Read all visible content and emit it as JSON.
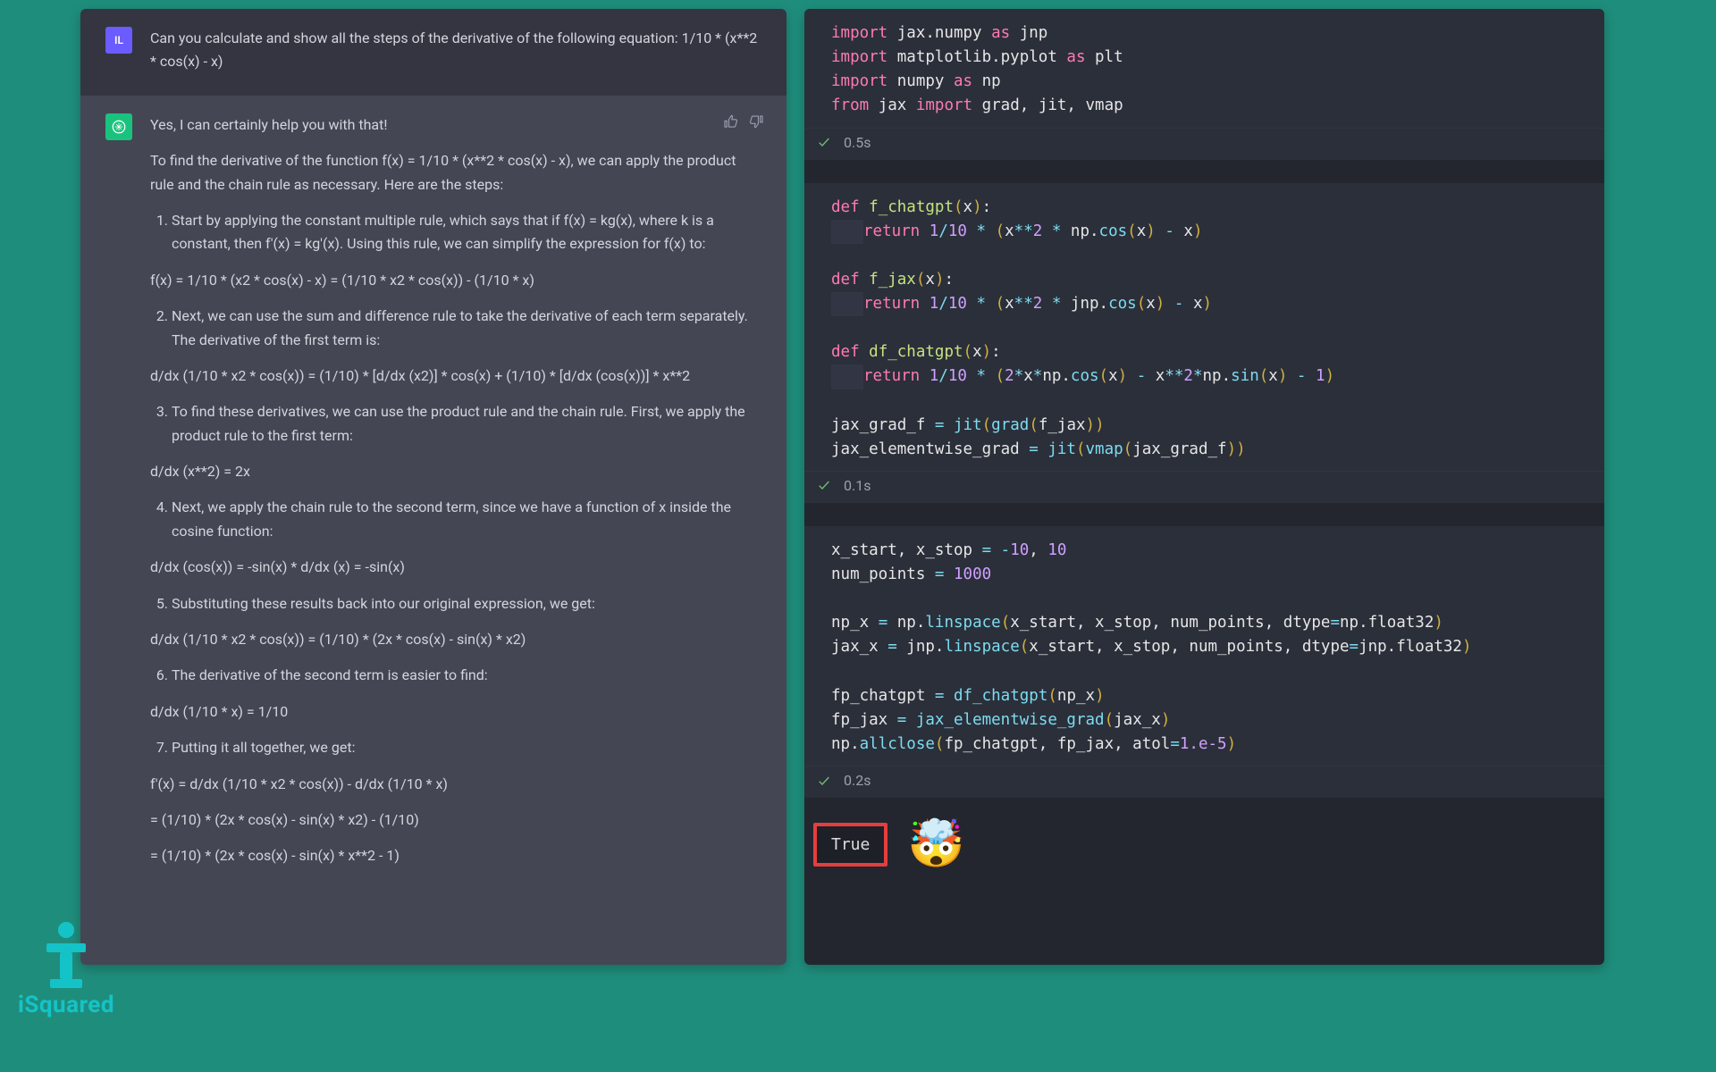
{
  "chat": {
    "user_initials": "IL",
    "user_prompt": "Can you calculate and show all the steps of the derivative of the following equation: 1/10 * (x**2 * cos(x) - x)",
    "ai_intro": "Yes, I can certainly help you with that!",
    "ai_p1": "To find the derivative of the function f(x) = 1/10 * (x**2 * cos(x) - x), we can apply the product rule and the chain rule as necessary. Here are the steps:",
    "step1": "Start by applying the constant multiple rule, which says that if f(x) = kg(x), where k is a constant, then f'(x) = kg'(x). Using this rule, we can simplify the expression for f(x) to:",
    "eq1": "f(x) = 1/10 * (x2 * cos(x) - x) = (1/10 * x2 * cos(x)) - (1/10 * x)",
    "step2": "Next, we can use the sum and difference rule to take the derivative of each term separately. The derivative of the first term is:",
    "eq2": "d/dx (1/10 * x2 * cos(x)) = (1/10) * [d/dx (x2)] * cos(x) + (1/10) * [d/dx (cos(x))] * x**2",
    "step3": "To find these derivatives, we can use the product rule and the chain rule. First, we apply the product rule to the first term:",
    "eq3": "d/dx (x**2) = 2x",
    "step4": "Next, we apply the chain rule to the second term, since we have a function of x inside the cosine function:",
    "eq4": "d/dx (cos(x)) = -sin(x) * d/dx (x) = -sin(x)",
    "step5": "Substituting these results back into our original expression, we get:",
    "eq5": "d/dx (1/10 * x2 * cos(x)) = (1/10) * (2x * cos(x) - sin(x) * x2)",
    "step6": "The derivative of the second term is easier to find:",
    "eq6": "d/dx (1/10 * x) = 1/10",
    "step7": "Putting it all together, we get:",
    "eq7a": "f'(x) = d/dx (1/10 * x2 * cos(x)) - d/dx (1/10 * x)",
    "eq7b": "= (1/10) * (2x * cos(x) - sin(x) * x2) - (1/10)",
    "eq7c": "= (1/10) * (2x * cos(x) - sin(x) * x**2 - 1)"
  },
  "code": {
    "cell1_time": "0.5s",
    "cell2_time": "0.1s",
    "cell3_time": "0.2s",
    "output": "True",
    "lines": {
      "c1l1": "import jax.numpy as jnp",
      "c1l2": "import matplotlib.pyplot as plt",
      "c1l3": "import numpy as np",
      "c1l4": "from jax import grad, jit, vmap",
      "c2l1": "def f_chatgpt(x):",
      "c2l2": "    return 1/10 * (x**2 * np.cos(x) - x)",
      "c2l3": "def f_jax(x):",
      "c2l4": "    return 1/10 * (x**2 * jnp.cos(x) - x)",
      "c2l5": "def df_chatgpt(x):",
      "c2l6": "    return 1/10 * (2*x*np.cos(x) - x**2*np.sin(x) - 1)",
      "c2l7": "jax_grad_f = jit(grad(f_jax))",
      "c2l8": "jax_elementwise_grad = jit(vmap(jax_grad_f))",
      "c3l1": "x_start, x_stop = -10, 10",
      "c3l2": "num_points = 1000",
      "c3l3": "np_x = np.linspace(x_start, x_stop, num_points, dtype=np.float32)",
      "c3l4": "jax_x = jnp.linspace(x_start, x_stop, num_points, dtype=jnp.float32)",
      "c3l5": "fp_chatgpt = df_chatgpt(np_x)",
      "c3l6": "fp_jax = jax_elementwise_grad(jax_x)",
      "c3l7": "np.allclose(fp_chatgpt, fp_jax, atol=1.e-5)"
    }
  },
  "logo_text": "iSquared"
}
